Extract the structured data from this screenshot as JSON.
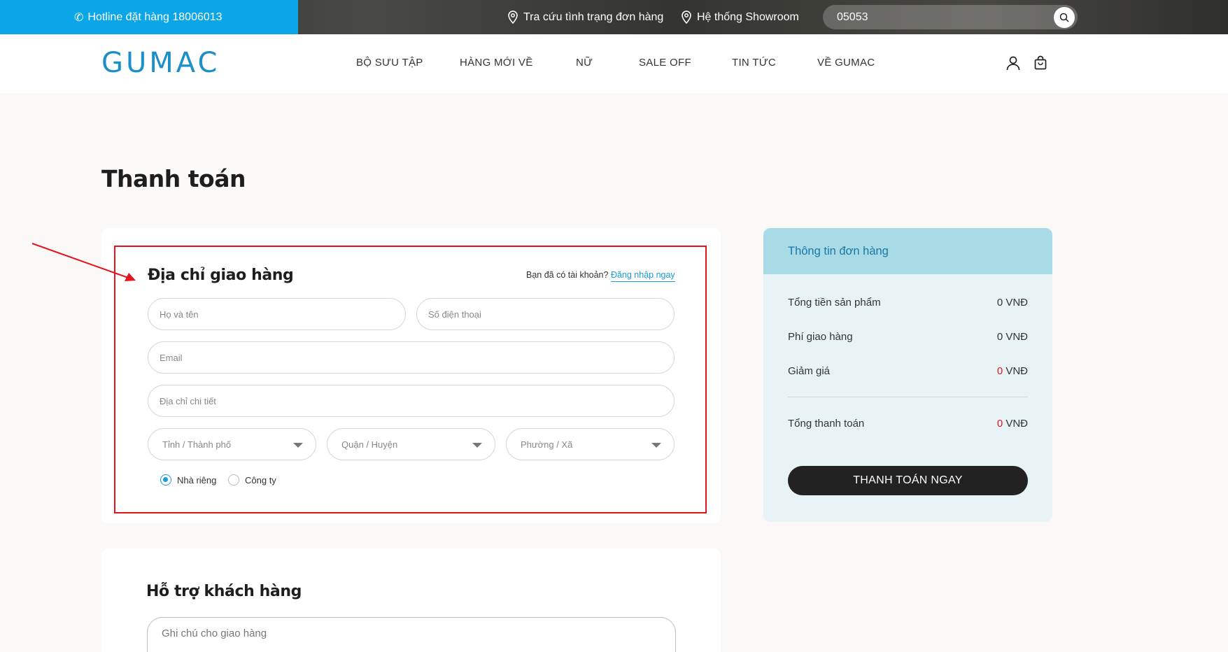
{
  "topbar": {
    "hotline": "Hotline đặt hàng 18006013",
    "track_order": "Tra cứu tình trạng đơn hàng",
    "showroom": "Hệ thống Showroom",
    "search_value": "05053"
  },
  "header": {
    "logo": "GUMAC",
    "nav": [
      "BỘ SƯU TẬP",
      "HÀNG MỚI VỀ",
      "NỮ",
      "SALE OFF",
      "TIN TỨC",
      "VỀ GUMAC"
    ]
  },
  "page": {
    "title": "Thanh toán"
  },
  "address": {
    "title": "Địa chỉ giao hàng",
    "have_account": "Bạn đã có tài khoản?",
    "login_link": "Đăng nhập ngay",
    "name_placeholder": "Họ và tên",
    "phone_placeholder": "Số điện thoại",
    "email_placeholder": "Email",
    "detail_placeholder": "Địa chỉ chi tiết",
    "province": "Tỉnh / Thành phố",
    "district": "Quận / Huyện",
    "ward": "Phường / Xã",
    "type_home": "Nhà riêng",
    "type_company": "Công ty"
  },
  "support": {
    "title": "Hỗ trợ khách hàng",
    "note_placeholder": "Ghi chú cho giao hàng"
  },
  "order": {
    "title": "Thông tin đơn hàng",
    "subtotal_label": "Tổng tiền sản phẩm",
    "subtotal_value": "0 VNĐ",
    "shipping_label": "Phí giao hàng",
    "shipping_value": "0 VNĐ",
    "discount_label": "Giảm giá",
    "discount_amount": "0",
    "currency": "VNĐ",
    "total_label": "Tổng thanh toán",
    "total_amount": "0",
    "pay_button": "THANH TOÁN NGAY"
  },
  "colors": {
    "accent": "#0aa6e8",
    "brand": "#1b8fc9",
    "highlight": "#e5131b",
    "order_header": "#a8dbe6"
  }
}
